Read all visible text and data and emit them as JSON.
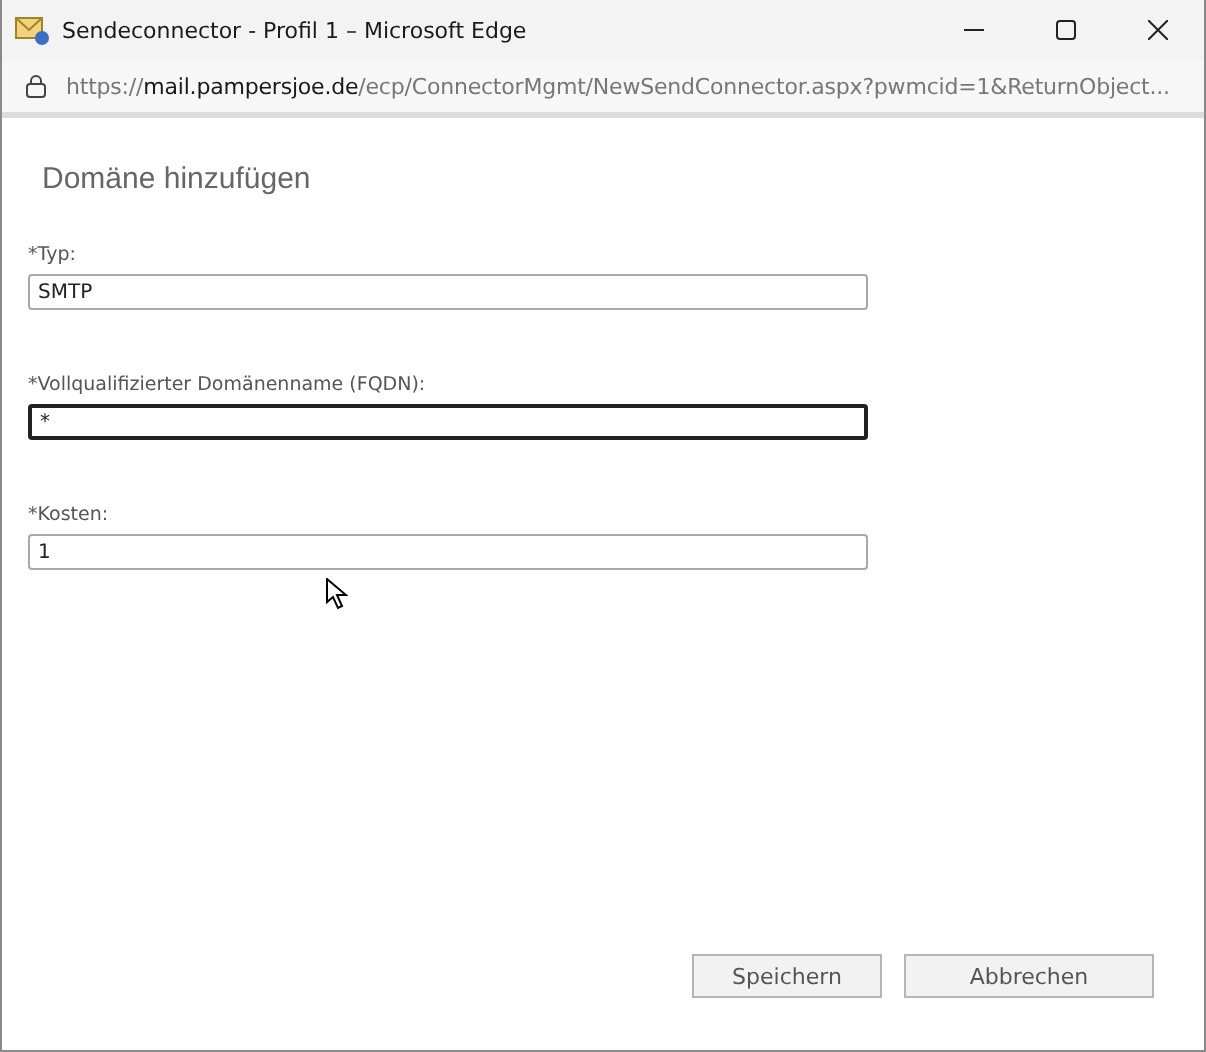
{
  "window": {
    "title": "Sendeconnector - Profil 1 – Microsoft Edge"
  },
  "address_bar": {
    "scheme": "https://",
    "host": "mail.pampersjoe.de",
    "path": "/ecp/ConnectorMgmt/NewSendConnector.aspx?pwmcid=1&ReturnObject..."
  },
  "dialog": {
    "title": "Domäne hinzufügen"
  },
  "fields": [
    {
      "label": "*Typ:",
      "value": "SMTP",
      "focused": false
    },
    {
      "label": "*Vollqualifizierter Domänenname (FQDN):",
      "value": "*",
      "focused": true
    },
    {
      "label": "*Kosten:",
      "value": "1",
      "focused": false
    }
  ],
  "buttons": [
    "Speichern",
    "Abbrechen"
  ]
}
